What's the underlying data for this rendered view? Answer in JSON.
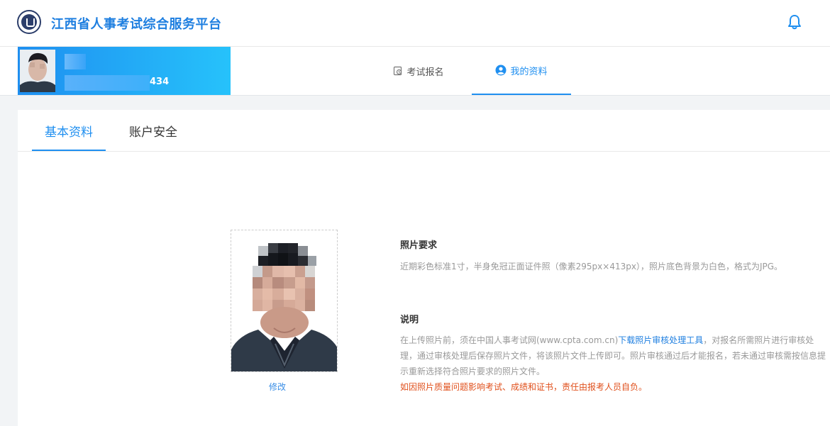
{
  "header": {
    "site_title": "江西省人事考试综合服务平台",
    "logo_icon": "emblem-logo",
    "bell_icon": "bell-icon"
  },
  "user_card": {
    "name_masked": "",
    "id_suffix": "434"
  },
  "nav": {
    "tabs": [
      {
        "label": "考试报名",
        "icon": "register-icon",
        "active": false
      },
      {
        "label": "我的资料",
        "icon": "user-circle-icon",
        "active": true
      }
    ]
  },
  "subtabs": [
    {
      "label": "基本资料",
      "active": true
    },
    {
      "label": "账户安全",
      "active": false
    }
  ],
  "photo": {
    "edit_label": "修改"
  },
  "requirements": {
    "title": "照片要求",
    "text": "近期彩色标准1寸，半身免冠正面证件照（像素295px×413px），照片底色背景为白色，格式为JPG。"
  },
  "notes": {
    "title": "说明",
    "text_before_link": "在上传照片前，须在中国人事考试网(www.cpta.com.cn)",
    "link_text": "下载照片审核处理工具",
    "text_after_link": "，对报名所需照片进行审核处理，通过审核处理后保存照片文件，将该照片文件上传即可。照片审核通过后才能报名，若未通过审核需按信息提示重新选择符合照片要求的照片文件。",
    "warning": "如因照片质量问题影响考试、成绩和证书，责任由报考人员自负。"
  },
  "colors": {
    "accent": "#1f8ff0",
    "warning": "#e0501c",
    "muted_text": "#999999"
  }
}
